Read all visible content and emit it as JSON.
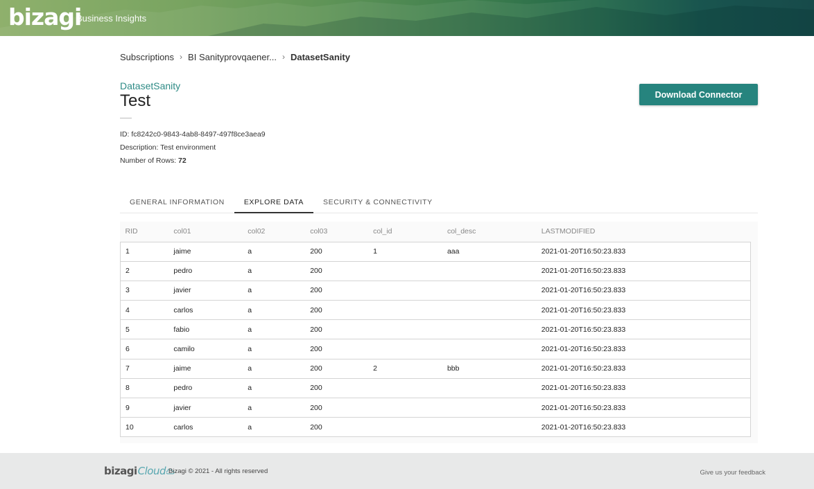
{
  "header": {
    "logo_text": "bizagi",
    "subtitle": "Business Insights"
  },
  "breadcrumb": {
    "items": [
      "Subscriptions",
      "BI Sanityprovqaener...",
      "DatasetSanity"
    ]
  },
  "dataset": {
    "link": "DatasetSanity",
    "title": "Test",
    "id_label": "ID: fc8242c0-9843-4ab8-8497-497f8ce3aea9",
    "description_label": "Description: Test environment",
    "rows_label": "Number of Rows: ",
    "rows_value": "72"
  },
  "actions": {
    "download_label": "Download Connector"
  },
  "tabs": [
    {
      "label": "GENERAL INFORMATION",
      "active": false
    },
    {
      "label": "EXPLORE DATA",
      "active": true
    },
    {
      "label": "SECURITY & CONNECTIVITY",
      "active": false
    }
  ],
  "table": {
    "columns": [
      "RID",
      "col01",
      "col02",
      "col03",
      "col_id",
      "col_desc",
      "LASTMODIFIED"
    ],
    "rows": [
      [
        "1",
        "jaime",
        "a",
        "200",
        "1",
        "aaa",
        "2021-01-20T16:50:23.833"
      ],
      [
        "2",
        "pedro",
        "a",
        "200",
        "",
        "",
        "2021-01-20T16:50:23.833"
      ],
      [
        "3",
        "javier",
        "a",
        "200",
        "",
        "",
        "2021-01-20T16:50:23.833"
      ],
      [
        "4",
        "carlos",
        "a",
        "200",
        "",
        "",
        "2021-01-20T16:50:23.833"
      ],
      [
        "5",
        "fabio",
        "a",
        "200",
        "",
        "",
        "2021-01-20T16:50:23.833"
      ],
      [
        "6",
        "camilo",
        "a",
        "200",
        "",
        "",
        "2021-01-20T16:50:23.833"
      ],
      [
        "7",
        "jaime",
        "a",
        "200",
        "2",
        "bbb",
        "2021-01-20T16:50:23.833"
      ],
      [
        "8",
        "pedro",
        "a",
        "200",
        "",
        "",
        "2021-01-20T16:50:23.833"
      ],
      [
        "9",
        "javier",
        "a",
        "200",
        "",
        "",
        "2021-01-20T16:50:23.833"
      ],
      [
        "10",
        "carlos",
        "a",
        "200",
        "",
        "",
        "2021-01-20T16:50:23.833"
      ]
    ]
  },
  "footer": {
    "logo_main": "bizagi",
    "logo_cloud": "Cloud",
    "copyright": "Bizagi © 2021 - All rights reserved",
    "feedback": "Give us your feedback"
  }
}
